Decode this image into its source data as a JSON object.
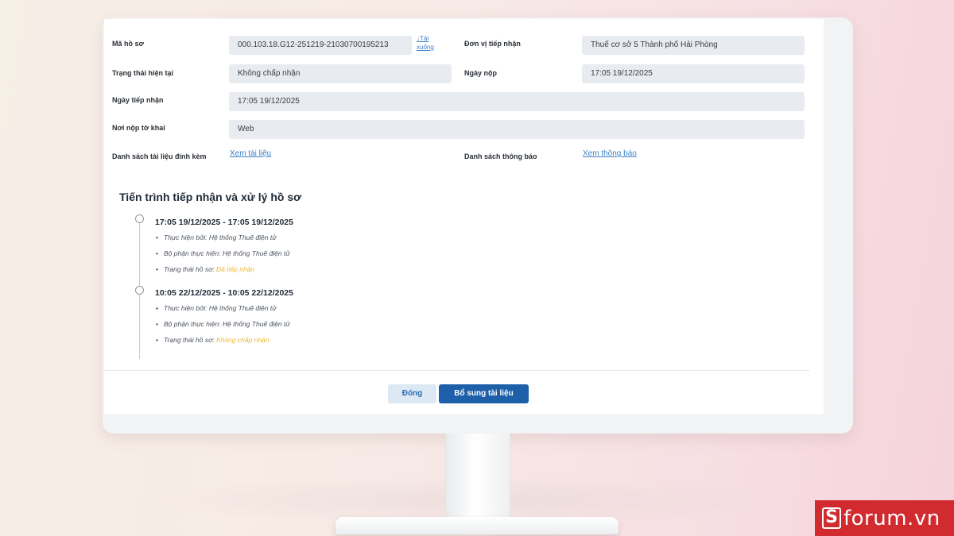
{
  "form": {
    "ma_ho_so_label": "Mã hồ sơ",
    "ma_ho_so_value": "000.103.18.G12-251219-21030700195213",
    "download_link": "↓Tải xuống",
    "don_vi_label": "Đơn vị tiếp nhận",
    "don_vi_value": "Thuế cơ sở 5 Thành phố Hải Phòng",
    "trang_thai_label": "Trạng thái hiện tại",
    "trang_thai_value": "Không chấp nhận",
    "ngay_nop_label": "Ngày nộp",
    "ngay_nop_value": "17:05 19/12/2025",
    "ngay_tiep_nhan_label": "Ngày tiếp nhận",
    "ngay_tiep_nhan_value": "17:05 19/12/2025",
    "noi_nop_label": "Nơi nộp tờ khai",
    "noi_nop_value": "Web",
    "tai_lieu_label": "Danh sách tài liệu đính kèm",
    "tai_lieu_link": "Xem tài liệu",
    "thong_bao_label": "Danh sách thông báo",
    "thong_bao_link": "Xem thông báo"
  },
  "timeline": {
    "title": "Tiến trình tiếp nhận và xử lý hồ sơ",
    "entries": [
      {
        "time_range": "17:05 19/12/2025 - 17:05 19/12/2025",
        "performed_by": "Thực hiện bởi: Hệ thống Thuế điện tử",
        "department": "Bộ phận thực hiện: Hệ thống Thuế điện tử",
        "status_label": "Trạng thái hồ sơ: ",
        "status_value": "Đã tiếp nhận"
      },
      {
        "time_range": "10:05 22/12/2025 - 10:05 22/12/2025",
        "performed_by": "Thực hiện bởi: Hệ thống Thuế điện tử",
        "department": "Bộ phận thực hiện: Hệ thống Thuế điện tử",
        "status_label": "Trạng thái hồ sơ: ",
        "status_value": "Không chấp nhận"
      }
    ]
  },
  "buttons": {
    "close": "Đóng",
    "add_docs": "Bổ sung tài liệu"
  },
  "logo": {
    "letter": "S",
    "text": "forum.vn"
  },
  "colors": {
    "accent": "#1d5fa8",
    "status": "#f0b93a",
    "brand": "#d12a2f"
  }
}
